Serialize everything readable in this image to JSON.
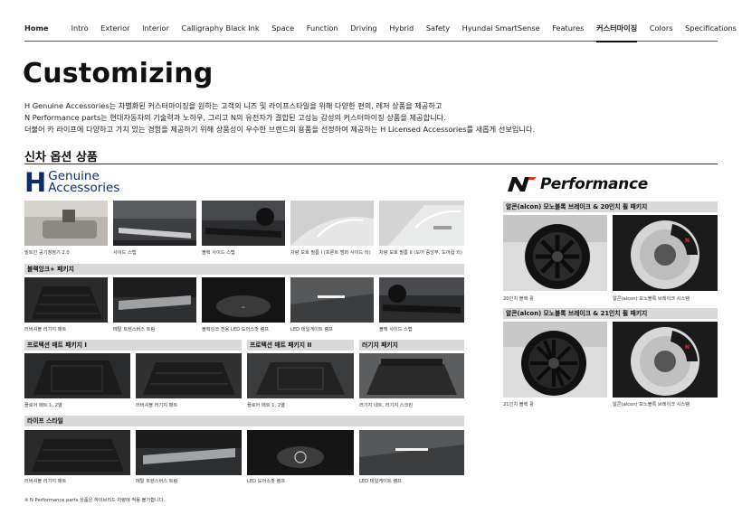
{
  "nav": {
    "home": "Home",
    "items": [
      "Intro",
      "Exterior",
      "Interior",
      "Calligraphy Black Ink",
      "Space",
      "Function",
      "Driving",
      "Hybrid",
      "Safety",
      "Hyundai SmartSense",
      "Features",
      "커스터마이징",
      "Colors",
      "Specifications"
    ],
    "active": "커스터마이징"
  },
  "title": "Customizing",
  "intro": [
    "H Genuine Accessories는 차별화된 커스터마이징을 원하는 고객의 니즈 및 라이프스타일을 위해 다양한 편의, 레저 상품을 제공하고",
    "N Performance parts는 현대자동차의 기술력과 노하우, 그리고 N의 유전자가 결합된 고성능 감성의 커스터마이징 상품을 제공합니다.",
    "더불어 카 라이프에 다양하고 가치 있는 경험을 제공하기 위해 상품성이 우수한 브랜드의 용품을 선정하여 제공하는 H Licensed Accessories를 새롭게 선보입니다."
  ],
  "section_title": "신차 옵션 상품",
  "logos": {
    "hga_mark": "H",
    "hga_line1": "Genuine",
    "hga_line2": "Accessories",
    "n_performance": "Performance"
  },
  "row1": {
    "captions": [
      "빌트인 공기청정기 2.0",
      "사이드 스텝",
      "블랙 사이드 스텝",
      "차량 보호 필름 I (프론트 범퍼 사이드 외)",
      "차량 보호 필름 II (도어 중앙부, 도어컵 외)"
    ]
  },
  "black_ink_package": {
    "title": "블랙잉크+ 패키지",
    "captions": [
      "러버셔블 러기지 매트",
      "메탈 트렌스버스 트림",
      "블랙잉크 전용 LED 도어스팟 램프",
      "LED 테일게이트 램프",
      "블랙 사이드 스텝"
    ]
  },
  "protection_mat_1": {
    "title": "프로텍션 매트 패키지 I",
    "captions": [
      "플로어 매트 1, 2열",
      "러버셔블 러기지 매트"
    ]
  },
  "protection_mat_2": {
    "title": "프로텍션 매트 패키지 II",
    "captions": [
      "플로어 매트 1, 2열"
    ]
  },
  "luggage_package": {
    "title": "러기지 패키지",
    "captions": [
      "러기지 네트, 러기지 스크린"
    ]
  },
  "lifestyle": {
    "title": "라이프 스타일",
    "captions": [
      "러버셔블 러기지 매트",
      "메탈 트렌스버스 트림",
      "LED 도어스팟 램프",
      "LED 테일게이트 램프"
    ]
  },
  "n_package_20": {
    "title": "알콘(alcon) 모노블록 브레이크 & 20인치 휠 패키지",
    "captions": [
      "20인치 블랙 휠",
      "알콘(alcon) 모노블록 브레이크 시스템"
    ]
  },
  "n_package_21": {
    "title": "알콘(alcon) 모노블록 브레이크 & 21인치 휠 패키지",
    "captions": [
      "21인치 블랙 휠",
      "알콘(alcon) 모노블록 브레이크 시스템"
    ]
  },
  "footnote": "※ N Performance parts 상품은 하이브리드 차량에 적용 불가합니다.",
  "colors": {
    "nav_underline": "#111111",
    "bar_bg": "#d9d9d9",
    "hga_blue": "#0b2d6b",
    "n_red": "#e0322d"
  }
}
